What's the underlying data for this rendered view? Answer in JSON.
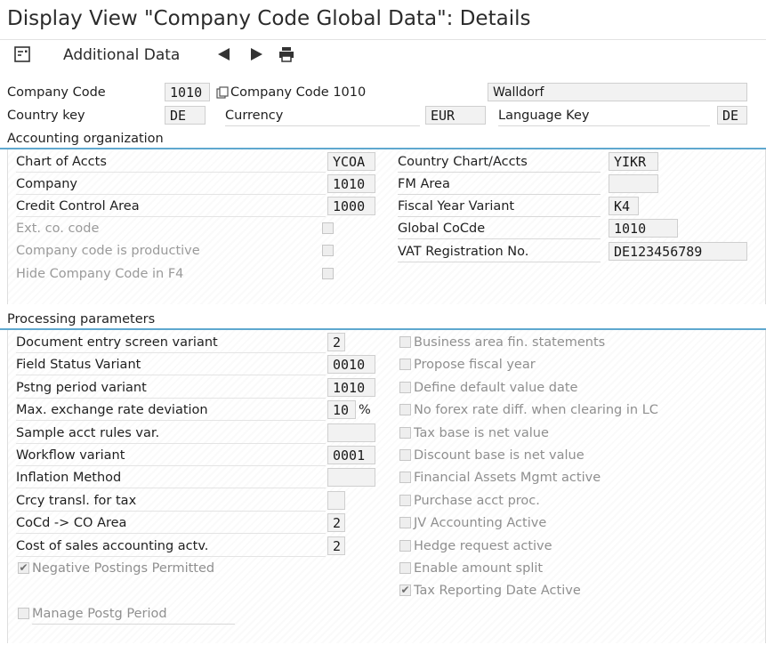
{
  "header": {
    "title": "Display View \"Company Code Global Data\": Details"
  },
  "toolbar": {
    "additional_data_label": "Additional Data",
    "icons": [
      "details-icon",
      "previous-arrow-icon",
      "next-arrow-icon",
      "print-icon"
    ]
  },
  "top": {
    "company_code_label": "Company Code",
    "company_code_value": "1010",
    "company_name": "Company Code 1010",
    "city": "Walldorf",
    "country_key_label": "Country key",
    "country_key_value": "DE",
    "currency_label": "Currency",
    "currency_value": "EUR",
    "language_key_label": "Language Key",
    "language_key_value": "DE"
  },
  "accounting_org": {
    "title": "Accounting organization",
    "chart_of_accts_label": "Chart of Accts",
    "chart_of_accts_value": "YCOA",
    "company_label": "Company",
    "company_value": "1010",
    "credit_control_area_label": "Credit Control Area",
    "credit_control_area_value": "1000",
    "ext_co_code_label": "Ext. co. code",
    "company_code_productive_label": "Company code is productive",
    "hide_company_code_label": "Hide Company Code in F4",
    "country_chart_label": "Country Chart/Accts",
    "country_chart_value": "YIKR",
    "fm_area_label": "FM Area",
    "fm_area_value": "",
    "fiscal_year_variant_label": "Fiscal Year Variant",
    "fiscal_year_variant_value": "K4",
    "global_cocde_label": "Global CoCde",
    "global_cocde_value": "1010",
    "vat_reg_label": "VAT Registration No.",
    "vat_reg_value": "DE123456789"
  },
  "processing": {
    "title": "Processing parameters",
    "doc_entry_screen_variant_label": "Document entry screen variant",
    "doc_entry_screen_variant_value": "2",
    "field_status_variant_label": "Field Status Variant",
    "field_status_variant_value": "0010",
    "pstng_period_variant_label": "Pstng period variant",
    "pstng_period_variant_value": "1010",
    "max_exchange_rate_label": "Max. exchange rate deviation",
    "max_exchange_rate_value": "10",
    "percent_sign": "%",
    "sample_acct_rules_label": "Sample acct rules var.",
    "sample_acct_rules_value": "",
    "workflow_variant_label": "Workflow variant",
    "workflow_variant_value": "0001",
    "inflation_method_label": "Inflation Method",
    "inflation_method_value": "",
    "crcy_transl_label": "Crcy transl. for tax",
    "crcy_transl_value": "",
    "cocd_co_area_label": "CoCd -> CO Area",
    "cocd_co_area_value": "2",
    "cost_of_sales_label": "Cost of sales accounting actv.",
    "cost_of_sales_value": "2",
    "negative_postings_label": "Negative Postings Permitted",
    "manage_postg_period_label": "Manage Postg Period",
    "business_area_label": "Business area fin. statements",
    "propose_fiscal_year_label": "Propose fiscal year",
    "define_default_value_date_label": "Define default value date",
    "no_forex_label": "No forex rate diff. when clearing in LC",
    "tax_base_net_label": "Tax base is net value",
    "discount_base_net_label": "Discount base is net value",
    "financial_assets_label": "Financial Assets Mgmt active",
    "purchase_acct_label": "Purchase acct proc.",
    "jv_accounting_label": "JV Accounting Active",
    "hedge_request_label": "Hedge request active",
    "enable_amount_split_label": "Enable amount split",
    "tax_reporting_date_label": "Tax Reporting Date Active"
  },
  "checkbox_states": {
    "ext_co_code": false,
    "company_code_productive": false,
    "hide_company_code": false,
    "negative_postings": true,
    "manage_postg_period": false,
    "business_area": false,
    "propose_fiscal_year": false,
    "define_default_value_date": false,
    "no_forex": false,
    "tax_base_net": false,
    "discount_base_net": false,
    "financial_assets": false,
    "purchase_acct": false,
    "jv_accounting": false,
    "hedge_request": false,
    "enable_amount_split": false,
    "tax_reporting_date": true
  },
  "colors": {
    "section_line": "#5fa8cf",
    "readonly_field_bg": "#f2f2f2",
    "disabled_text": "#9a9a9a"
  }
}
